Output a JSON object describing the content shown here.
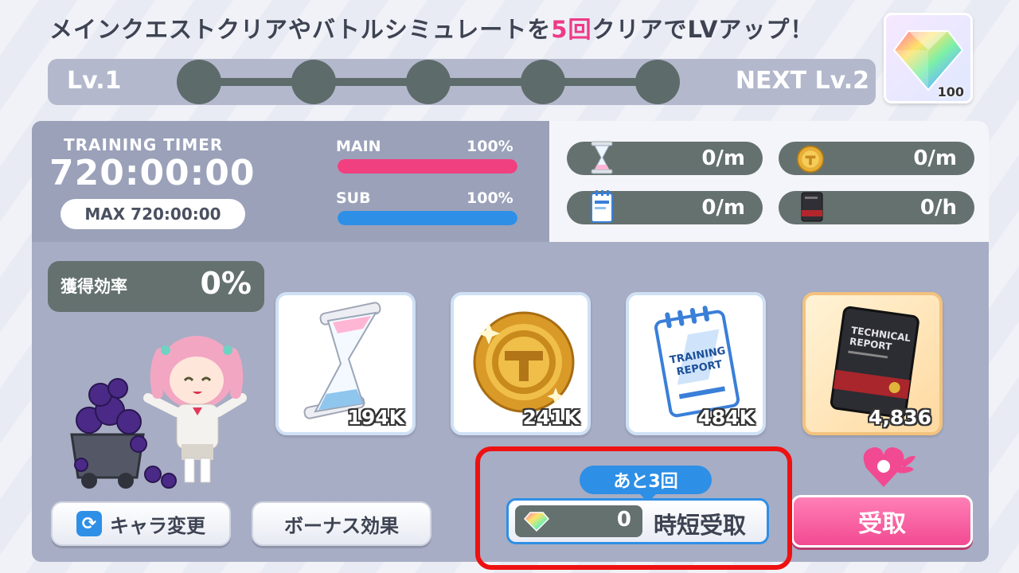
{
  "header": {
    "message_part1": "メインクエストクリアやバトルシミュレートを",
    "message_accent": "5回",
    "message_part2": "クリアでLVアップ！",
    "current_level": "Lv.1",
    "next_level": "NEXT Lv.2",
    "reward": {
      "icon": "rainbow-gem-icon",
      "count": "100"
    }
  },
  "level_progress": {
    "steps_total": 5,
    "steps_done": 0
  },
  "timer": {
    "title": "TRAINING TIMER",
    "value": "720:00:00",
    "max": "MAX 720:00:00"
  },
  "bars": [
    {
      "label": "MAIN",
      "percent": "100%",
      "fill": 1.0,
      "color": "#f0407f"
    },
    {
      "label": "SUB",
      "percent": "100%",
      "fill": 1.0,
      "color": "#2e8fe6"
    }
  ],
  "rates": [
    {
      "icon": "hourglass-icon",
      "value": "0/m"
    },
    {
      "icon": "gold-coin-icon",
      "value": "0/m"
    },
    {
      "icon": "training-report-icon",
      "value": "0/m"
    },
    {
      "icon": "technical-report-icon",
      "value": "0/h"
    }
  ],
  "efficiency": {
    "label": "獲得効率",
    "value": "0%"
  },
  "items": [
    {
      "icon": "hourglass-icon",
      "count": "194K"
    },
    {
      "icon": "gold-coin-icon",
      "count": "241K"
    },
    {
      "icon": "training-report-icon",
      "count": "484K"
    },
    {
      "icon": "technical-report-icon",
      "count": "4,836"
    }
  ],
  "buttons": {
    "change_character": "キャラ変更",
    "bonus_effect": "ボーナス効果",
    "remaining": "あと3回",
    "quick_cost": "0",
    "quick_claim": "時短受取",
    "claim": "受取"
  }
}
